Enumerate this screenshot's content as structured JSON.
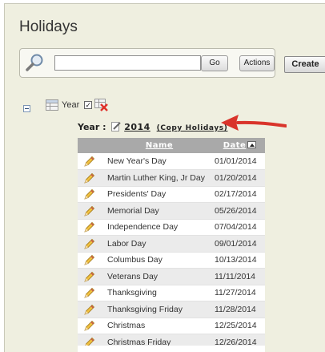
{
  "page": {
    "title": "Holidays"
  },
  "search": {
    "value": "",
    "placeholder": "",
    "go_label": "Go",
    "actions_label": "Actions"
  },
  "toolbar": {
    "create_label": "Create"
  },
  "tree": {
    "year_label": "Year"
  },
  "year_heading": {
    "prefix": "Year :",
    "year": "2014",
    "copy_link": "(Copy Holidays)"
  },
  "table": {
    "headers": {
      "name": "Name",
      "date": "Date"
    },
    "rows": [
      {
        "name": "New Year's Day",
        "date": "01/01/2014"
      },
      {
        "name": "Martin Luther King, Jr Day",
        "date": "01/20/2014"
      },
      {
        "name": "Presidents' Day",
        "date": "02/17/2014"
      },
      {
        "name": "Memorial Day",
        "date": "05/26/2014"
      },
      {
        "name": "Independence Day",
        "date": "07/04/2014"
      },
      {
        "name": "Labor Day",
        "date": "09/01/2014"
      },
      {
        "name": "Columbus Day",
        "date": "10/13/2014"
      },
      {
        "name": "Veterans Day",
        "date": "11/11/2014"
      },
      {
        "name": "Thanksgiving",
        "date": "11/27/2014"
      },
      {
        "name": "Thanksgiving Friday",
        "date": "11/28/2014"
      },
      {
        "name": "Christmas",
        "date": "12/25/2014"
      },
      {
        "name": "Christmas Friday",
        "date": "12/26/2014"
      }
    ]
  },
  "colors": {
    "panel_bg": "#efefe0",
    "header_bg": "#a9a9a9",
    "row_alt": "#ebebeb",
    "arrow": "#d9342b",
    "pencil": "#e8b52a"
  }
}
